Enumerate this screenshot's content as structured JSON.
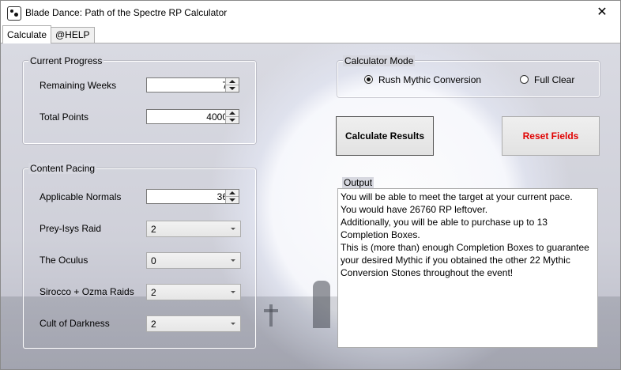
{
  "window": {
    "title": "Blade Dance: Path of the Spectre RP Calculator"
  },
  "tabs": [
    {
      "label": "Calculate",
      "active": true
    },
    {
      "label": "@HELP",
      "active": false
    }
  ],
  "current_progress": {
    "legend": "Current Progress",
    "remaining_weeks": {
      "label": "Remaining Weeks",
      "value": "7"
    },
    "total_points": {
      "label": "Total Points",
      "value": "4000"
    }
  },
  "content_pacing": {
    "legend": "Content Pacing",
    "applicable_normals": {
      "label": "Applicable Normals",
      "value": "36"
    },
    "prey_isys_raid": {
      "label": "Prey-Isys Raid",
      "value": "2"
    },
    "the_oculus": {
      "label": "The Oculus",
      "value": "0"
    },
    "sirocco_ozma": {
      "label": "Sirocco + Ozma Raids",
      "value": "2"
    },
    "cult_of_darkness": {
      "label": "Cult of Darkness",
      "value": "2"
    }
  },
  "calculator_mode": {
    "legend": "Calculator Mode",
    "options": [
      {
        "label": "Rush Mythic Conversion",
        "checked": true
      },
      {
        "label": "Full Clear",
        "checked": false
      }
    ]
  },
  "buttons": {
    "calculate": "Calculate Results",
    "reset": "Reset Fields"
  },
  "output": {
    "legend": "Output",
    "lines": [
      "You will be able to meet the target at your current pace.",
      "You would have 26760 RP leftover.",
      "Additionally, you will be able to purchase up to 13",
      "Completion Boxes.",
      "This is (more than) enough Completion Boxes to guarantee",
      "your desired Mythic if you obtained the other 22 Mythic",
      "Conversion Stones throughout the event!"
    ]
  },
  "colors": {
    "reset_text": "#e00000",
    "tab_border": "#adadad"
  }
}
